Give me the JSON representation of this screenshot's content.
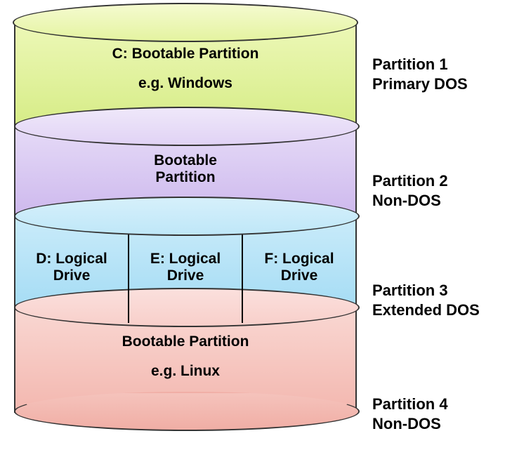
{
  "partitions": [
    {
      "title": "C: Bootable Partition",
      "subtitle": "e.g. Windows",
      "label_line1": "Partition 1",
      "label_line2": "Primary DOS",
      "color": "#d6ec86"
    },
    {
      "title": "Bootable",
      "subtitle": "Partition",
      "label_line1": "Partition 2",
      "label_line2": "Non-DOS",
      "color": "#cdb8ed"
    },
    {
      "drives": [
        {
          "line1": "D: Logical",
          "line2": "Drive"
        },
        {
          "line1": "E: Logical",
          "line2": "Drive"
        },
        {
          "line1": "F: Logical",
          "line2": "Drive"
        }
      ],
      "label_line1": "Partition 3",
      "label_line2": "Extended DOS",
      "color": "#a5dcf4"
    },
    {
      "title": "Bootable Partition",
      "subtitle": "e.g. Linux",
      "label_line1": "Partition 4",
      "label_line2": "Non-DOS",
      "color": "#f3b7af"
    }
  ]
}
